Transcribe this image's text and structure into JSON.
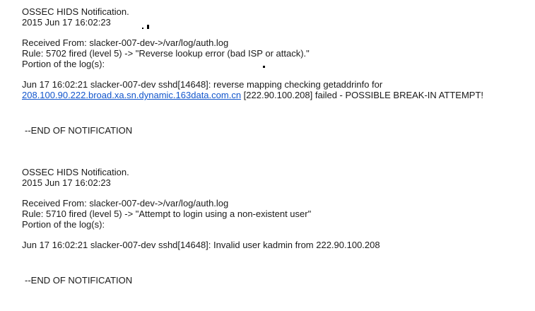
{
  "notifications": [
    {
      "title": "OSSEC HIDS Notification.",
      "timestamp": "2015 Jun 17 16:02:23",
      "received_from": "Received From: slacker-007-dev->/var/log/auth.log",
      "rule": "Rule: 5702 fired (level 5) -> \"Reverse lookup error (bad ISP or attack).\"",
      "portion": "Portion of the log(s):",
      "log_prefix": "Jun 17 16:02:21 slacker-007-dev sshd[14648]: reverse mapping checking getaddrinfo for ",
      "log_link": "208.100.90.222.broad.xa.sn.dynamic.163data.com.cn",
      "log_suffix": " [222.90.100.208] failed - POSSIBLE BREAK-IN ATTEMPT!",
      "end": "--END OF NOTIFICATION"
    },
    {
      "title": "OSSEC HIDS Notification.",
      "timestamp": "2015 Jun 17 16:02:23",
      "received_from": "Received From: slacker-007-dev->/var/log/auth.log",
      "rule": "Rule: 5710 fired (level 5) -> \"Attempt to login using a non-existent user\"",
      "portion": "Portion of the log(s):",
      "log_line": "Jun 17 16:02:21 slacker-007-dev sshd[14648]: Invalid user kadmin from 222.90.100.208",
      "end": "--END OF NOTIFICATION"
    }
  ]
}
